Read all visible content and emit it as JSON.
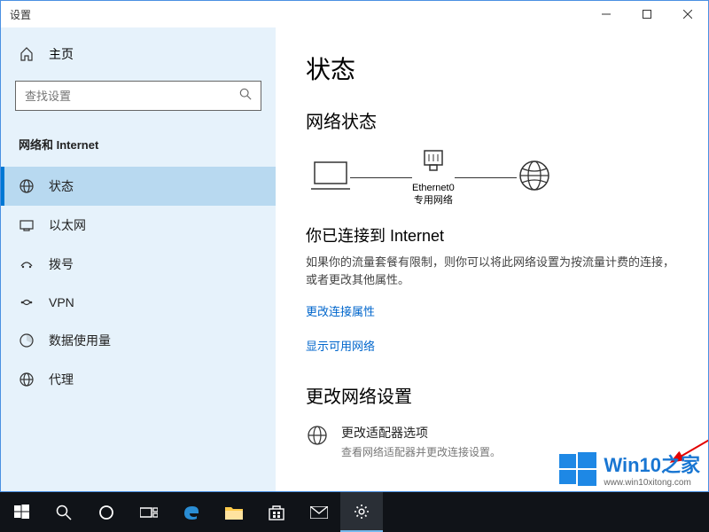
{
  "titlebar": {
    "title": "设置"
  },
  "sidebar": {
    "home": "主页",
    "search_placeholder": "查找设置",
    "section": "网络和 Internet",
    "items": [
      {
        "label": "状态"
      },
      {
        "label": "以太网"
      },
      {
        "label": "拨号"
      },
      {
        "label": "VPN"
      },
      {
        "label": "数据使用量"
      },
      {
        "label": "代理"
      }
    ]
  },
  "content": {
    "heading": "状态",
    "net_status": "网络状态",
    "ethernet_name": "Ethernet0",
    "ethernet_type": "专用网络",
    "connected_title": "你已连接到 Internet",
    "connected_desc": "如果你的流量套餐有限制，则你可以将此网络设置为按流量计费的连接，或者更改其他属性。",
    "link_props": "更改连接属性",
    "link_avail": "显示可用网络",
    "change_settings": "更改网络设置",
    "adapter_title": "更改适配器选项",
    "adapter_desc": "查看网络适配器并更改连接设置。"
  },
  "watermark": {
    "brand": "Win10之家",
    "url": "www.win10xitong.com"
  }
}
